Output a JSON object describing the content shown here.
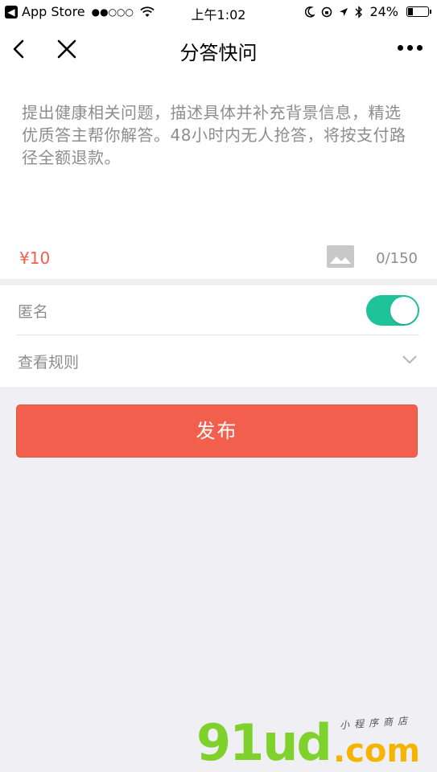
{
  "status_bar": {
    "back_app": "App Store",
    "signal": "●●○○○",
    "time": "上午1:02",
    "battery": "24%"
  },
  "nav": {
    "title": "分答快问"
  },
  "editor": {
    "placeholder": "提出健康相关问题，描述具体并补充背景信息，精选优质答主帮你解答。48小时内无人抢答，将按支付路径全额退款。",
    "price": "¥10",
    "counter": "0/150"
  },
  "options": {
    "anonymous_label": "匿名",
    "anonymous_on": true,
    "rules_label": "查看规则"
  },
  "publish_label": "发布",
  "watermark": {
    "logo": "91ud",
    "domain": ".com",
    "sub": "小程序商店"
  },
  "colors": {
    "accent": "#f2604d",
    "toggle": "#1fc39a",
    "placeholder": "#8d8d8d",
    "background": "#efeff4"
  }
}
